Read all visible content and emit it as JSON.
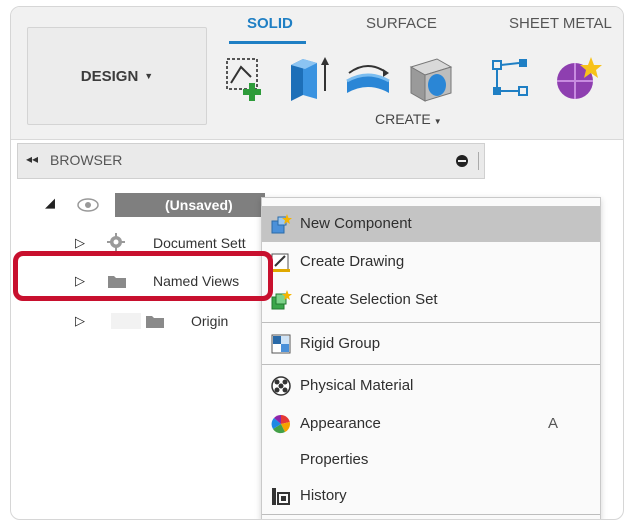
{
  "toolbar": {
    "workspace_label": "DESIGN",
    "tabs": [
      {
        "label": "SOLID",
        "active": true
      },
      {
        "label": "SURFACE",
        "active": false
      },
      {
        "label": "SHEET METAL",
        "active": false
      }
    ],
    "create_label": "CREATE",
    "tools": [
      "create-sketch-icon",
      "extrude-icon",
      "revolve-icon",
      "shell-icon",
      "create-form-icon",
      "create-base-feature-icon"
    ],
    "accent_color": "#1f7fc4"
  },
  "browser": {
    "title": "BROWSER",
    "tree": [
      {
        "label": "(Unsaved)"
      },
      {
        "label": "Document Sett"
      },
      {
        "label": "Named Views"
      },
      {
        "label": "Origin"
      }
    ]
  },
  "context_menu": {
    "items": [
      {
        "label": "New Component",
        "icon": "new-component-icon",
        "hover": true
      },
      {
        "label": "Create Drawing",
        "icon": "create-drawing-icon"
      },
      {
        "label": "Create Selection Set",
        "icon": "create-selection-set-icon"
      },
      {
        "label": "Rigid Group",
        "icon": "rigid-group-icon"
      },
      {
        "label": "Physical Material",
        "icon": "physical-material-icon"
      },
      {
        "label": "Appearance",
        "icon": "appearance-icon",
        "shortcut": "A"
      },
      {
        "label": "Properties",
        "icon": ""
      },
      {
        "label": "History",
        "icon": "history-icon"
      }
    ]
  },
  "highlight_color": "#c8102e"
}
